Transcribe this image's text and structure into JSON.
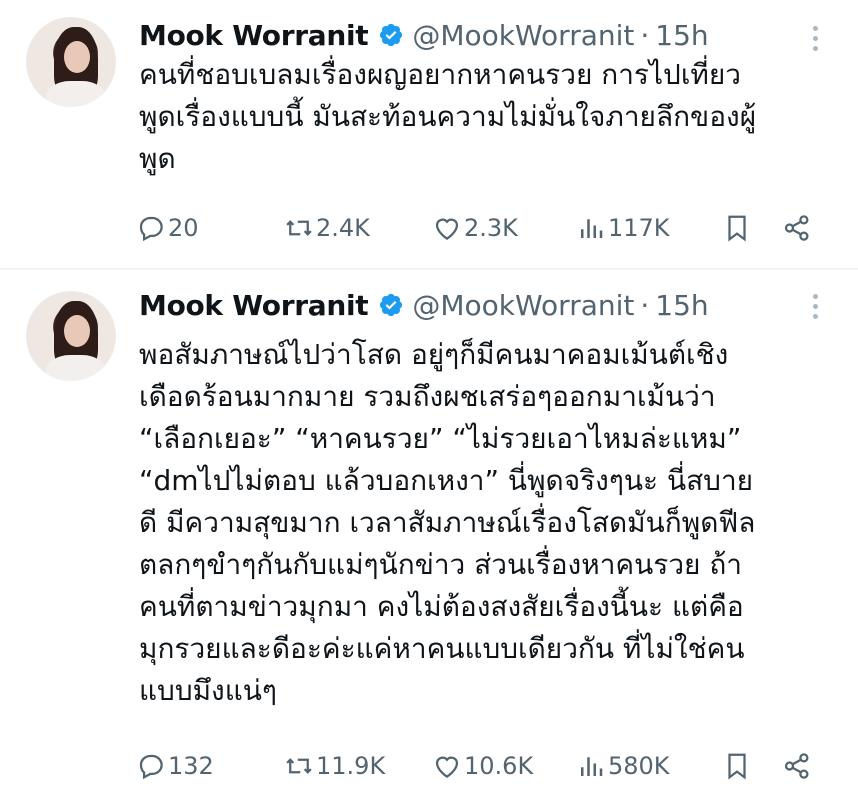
{
  "tweets": [
    {
      "author_name": "Mook Worranit",
      "handle": "@MookWorranit",
      "separator": "·",
      "time": "15h",
      "text_lines": [
        "คนที่ชอบเบลมเรื่องผญอยากหาคนรวย การไปเที่ยว",
        "พูดเรื่องแบบนี้ มันสะท้อนความไม่มั่นใจภายลึกของผู้",
        "พูด"
      ],
      "replies": "20",
      "retweets": "2.4K",
      "likes": "2.3K",
      "views": "117K"
    },
    {
      "author_name": "Mook Worranit",
      "handle": "@MookWorranit",
      "separator": "·",
      "time": "15h",
      "text_lines": [
        "พอสัมภาษณ์ไปว่าโสด อยู่ๆก็มีคนมาคอมเม้นต์เชิง",
        "เดือดร้อนมากมาย รวมถึงผชเสร่อๆออกมาเม้นว่า",
        "“เลือกเยอะ” “หาคนรวย”  “ไม่รวยเอาไหมล่ะแหม”",
        "“dmไปไม่ตอบ แล้วบอกเหงา” นี่พูดจริงๆนะ นี่สบาย",
        "ดี มีความสุขมาก เวลาสัมภาษณ์เรื่องโสดมันก็พูดฟีล",
        "ตลกๆขำๆกันกับแม่ๆนักข่าว ส่วนเรื่องหาคนรวย ถ้า",
        "คนที่ตามข่าวมุกมา คงไม่ต้องสงสัยเรื่องนี้นะ แต่คือ",
        "มุกรวยและดีอะค่ะแค่หาคนแบบเดียวกัน ที่ไม่ใช่คน",
        "แบบมึงแน่ๆ"
      ],
      "replies": "132",
      "retweets": "11.9K",
      "likes": "10.6K",
      "views": "580K"
    }
  ],
  "icons": {
    "verified": "verified-badge-icon",
    "more": "more-options-icon",
    "reply": "reply-icon",
    "retweet": "retweet-icon",
    "like": "like-icon",
    "views": "views-icon",
    "bookmark": "bookmark-icon",
    "share": "share-icon"
  },
  "colors": {
    "verified": "#1d9bf0",
    "muted": "#536471",
    "text": "#0f1419"
  }
}
